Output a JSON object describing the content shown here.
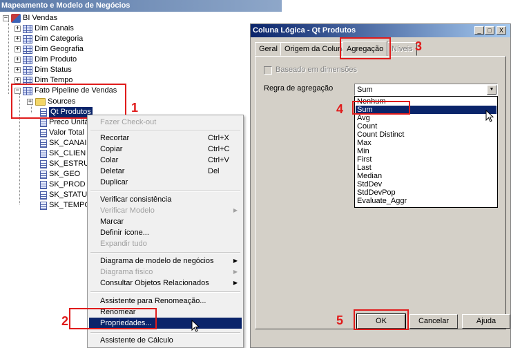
{
  "left_pane": {
    "title": "Mapeamento e Modelo de Negócios",
    "root": "BI Vendas",
    "dims": [
      "Dim Canais",
      "Dim Categoria",
      "Dim Geografia",
      "Dim Produto",
      "Dim Status",
      "Dim Tempo"
    ],
    "fact": "Fato Pipeline de Vendas",
    "sources": "Sources",
    "selected_column": "Qt Produtos",
    "columns": [
      "Preco Unitá",
      "Valor Total",
      "SK_CANAI",
      "SK_CLIEN",
      "SK_ESTRU",
      "SK_GEO",
      "SK_PROD",
      "SK_STATU",
      "SK_TEMPO"
    ]
  },
  "context_menu": {
    "items": [
      {
        "label": "Fazer Check-out",
        "disabled": true
      },
      {
        "label": "Recortar",
        "shortcut": "Ctrl+X"
      },
      {
        "label": "Copiar",
        "shortcut": "Ctrl+C"
      },
      {
        "label": "Colar",
        "shortcut": "Ctrl+V"
      },
      {
        "label": "Deletar",
        "shortcut": "Del"
      },
      {
        "label": "Duplicar"
      },
      {
        "label": "Verificar consistência"
      },
      {
        "label": "Verificar Modelo",
        "disabled": true
      },
      {
        "label": "Marcar"
      },
      {
        "label": "Definir ícone..."
      },
      {
        "label": "Expandir tudo",
        "disabled": true
      },
      {
        "label": "Diagrama de modelo de negócios"
      },
      {
        "label": "Diagrama físico",
        "disabled": true
      },
      {
        "label": "Consultar Objetos Relacionados"
      },
      {
        "label": "Assistente para Renomeação..."
      },
      {
        "label": "Renomear"
      },
      {
        "label": "Propriedades..."
      },
      {
        "label": "Assistente de Cálculo"
      }
    ]
  },
  "dialog": {
    "title": "Coluna Lógica - Qt Produtos",
    "title_buttons": [
      "_",
      "□",
      "X"
    ],
    "tabs": [
      "Geral",
      "Origem da Coluna",
      "Agregação",
      "Níveis"
    ],
    "active_tab": "Agregação",
    "checkbox_label": "Baseado em dimensões",
    "aggregation_rule_label": "Regra de agregação",
    "aggregation_value": "Sum",
    "options": [
      "Nenhum",
      "Sum",
      "Avg",
      "Count",
      "Count Distinct",
      "Max",
      "Min",
      "First",
      "Last",
      "Median",
      "StdDev",
      "StdDevPop",
      "Evaluate_Aggr"
    ],
    "selected_option": "Sum",
    "buttons": {
      "ok": "OK",
      "cancel": "Cancelar",
      "help": "Ajuda"
    }
  },
  "annotations": [
    "1",
    "2",
    "3",
    "4",
    "5"
  ],
  "colors": {
    "annotation": "#e01b1b",
    "selection": "#0a246a",
    "dialog_bg": "#d4d0c8"
  }
}
